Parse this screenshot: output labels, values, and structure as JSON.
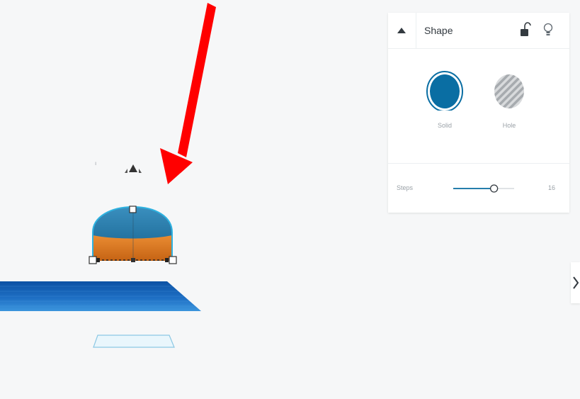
{
  "inspector": {
    "title": "Shape",
    "collapse_icon": "caret-up-icon",
    "lock_icon": "unlock-icon",
    "visibility_icon": "lightbulb-icon",
    "fill_options": [
      {
        "label": "Solid",
        "icon": "solid-color-swatch",
        "color": "#0a6ea3",
        "selected": true
      },
      {
        "label": "Hole",
        "icon": "hole-striped-swatch",
        "color": "#b9bcbf",
        "selected": false
      }
    ],
    "steps": {
      "label": "Steps",
      "value": "16",
      "slider_fraction": 0.67
    }
  },
  "scene": {
    "shape_top_color": "#1e74a0",
    "shape_bottom_color": "#e07a1e",
    "workplane_color": "#1d63b3",
    "selection_outline_color": "#2fb2e0",
    "annotation_arrow_color": "#ff0000"
  },
  "side_panel_toggle_icon": "chevron-right-icon"
}
